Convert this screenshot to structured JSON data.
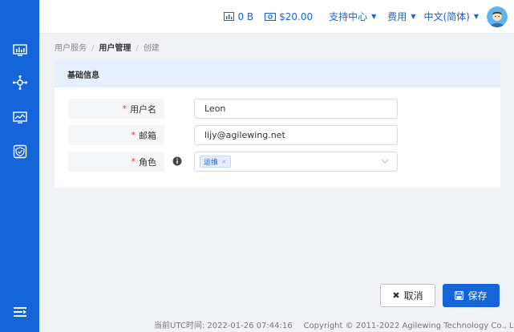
{
  "topbar": {
    "traffic": "0 B",
    "balance": "$20.00",
    "support": "支持中心",
    "billing": "费用",
    "language": "中文(简体)"
  },
  "sidebar": {
    "icons": [
      "monitor-stats-icon",
      "network-node-icon",
      "monitor-chart-icon",
      "shield-icon",
      "menu-collapse-icon"
    ]
  },
  "breadcrumb": {
    "items": [
      "用户服务",
      "用户管理",
      "创建"
    ]
  },
  "form": {
    "section_title": "基础信息",
    "fields": {
      "username": {
        "label": "用户名",
        "required": "*",
        "value": "Leon"
      },
      "email": {
        "label": "邮箱",
        "required": "*",
        "value": "lijy@agilewing.net"
      },
      "role": {
        "label": "角色",
        "required": "*",
        "tag": "运维",
        "tag_remove": "×"
      }
    }
  },
  "actions": {
    "cancel_label": "取消",
    "save_label": "保存"
  },
  "footer": {
    "utc_time": "当前UTC时间: 2022-01-26 07:44:16",
    "copyright": "Copyright © 2011-2022 Agilewing Technology Co., Ltd."
  },
  "colors": {
    "primary": "#1565d8",
    "section_bg": "#e8effc",
    "required": "#e53935"
  }
}
